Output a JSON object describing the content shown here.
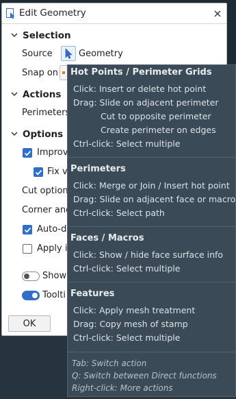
{
  "dialog": {
    "title": "Edit Geometry",
    "sections": {
      "selection": "Selection",
      "actions": "Actions",
      "options": "Options"
    },
    "source_label": "Source",
    "source_value": "Geometry",
    "snap_label": "Snap on",
    "actions_row_label": "Perimeters",
    "options": {
      "improve_label": "Improv",
      "improve_checked": true,
      "fix_label": "Fix vi",
      "fix_checked": true,
      "cut_label": "Cut option",
      "corner_label": "Corner ang",
      "auto_label": "Auto-de",
      "auto_checked": true,
      "apply_label": "Apply is",
      "apply_checked": false,
      "show_label": "Show",
      "show_on": false,
      "tooltips_label": "Toolti",
      "tooltips_on": true
    },
    "ok_label": "OK"
  },
  "tooltip": {
    "groups": [
      {
        "heading": "Hot Points / Perimeter Grids",
        "lines": [
          "Click: Insert or delete hot point",
          "Drag: Slide on adjacent perimeter",
          "Cut to opposite perimeter",
          "Create perimeter on edges",
          "Ctrl-click: Select multiple"
        ]
      },
      {
        "heading": "Perimeters",
        "lines": [
          "Click: Merge or Join / Insert hot point",
          "Drag: Slide on adjacent face or macro",
          "Ctrl-click: Select path"
        ]
      },
      {
        "heading": "Faces / Macros",
        "lines": [
          "Click: Show / hide face surface info",
          "Ctrl-click: Select multiple"
        ]
      },
      {
        "heading": "Features",
        "lines": [
          "Click: Apply mesh treatment",
          "Drag: Copy mesh of stamp",
          "Ctrl-click: Select multiple"
        ]
      }
    ],
    "footer": [
      "Tab: Switch action",
      "Q: Switch between Direct functions",
      "Right-click: More actions"
    ]
  },
  "colors": {
    "accent": "#2f6fc9",
    "tooltip_bg": "#3a4a57",
    "dialog_bg": "#ffffff",
    "desktop_bg": "#1e2a34"
  }
}
